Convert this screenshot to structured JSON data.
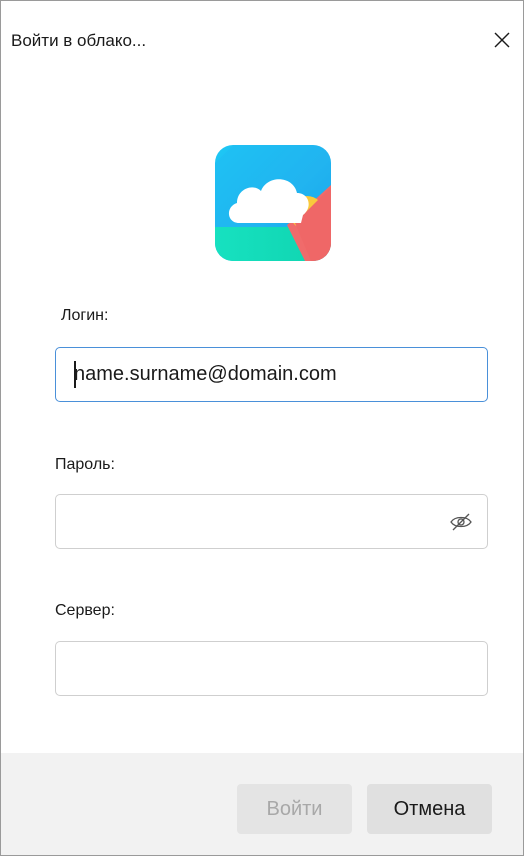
{
  "window": {
    "title": "Войти в облако..."
  },
  "form": {
    "login_label": "Логин:",
    "login_value": "name.surname@domain.com",
    "password_label": "Пароль:",
    "password_value": "",
    "server_label": "Сервер:",
    "server_value": ""
  },
  "buttons": {
    "ok_label": "Войти",
    "cancel_label": "Отмена"
  },
  "icons": {
    "close": "close-icon",
    "logo": "cloud-app-logo",
    "password_toggle": "eye-slash-icon"
  },
  "colors": {
    "focus_border": "#4a90d9",
    "footer_bg": "#f2f2f2"
  }
}
